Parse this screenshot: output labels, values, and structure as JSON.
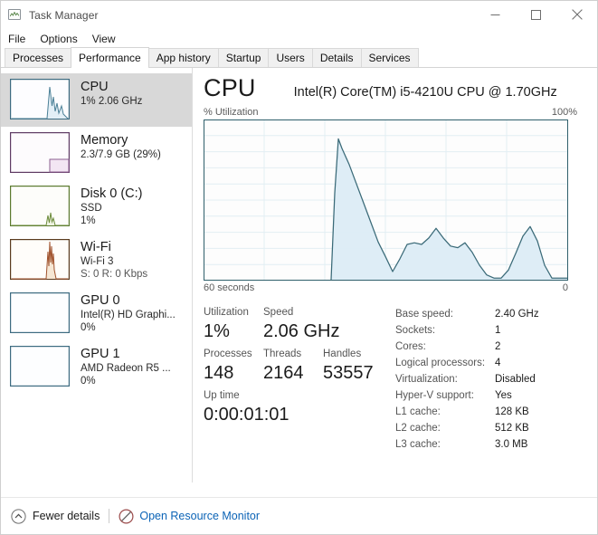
{
  "window": {
    "title": "Task Manager",
    "icon": "task-manager-icon",
    "minimize_label": "Minimize",
    "maximize_label": "Maximize",
    "close_label": "Close"
  },
  "menubar": {
    "items": [
      {
        "label": "File"
      },
      {
        "label": "Options"
      },
      {
        "label": "View"
      }
    ]
  },
  "tabs": [
    {
      "label": "Processes",
      "active": false
    },
    {
      "label": "Performance",
      "active": true
    },
    {
      "label": "App history",
      "active": false
    },
    {
      "label": "Startup",
      "active": false
    },
    {
      "label": "Users",
      "active": false
    },
    {
      "label": "Details",
      "active": false
    },
    {
      "label": "Services",
      "active": false
    }
  ],
  "sidebar": {
    "items": [
      {
        "name": "cpu",
        "title": "CPU",
        "line1": "1%  2.06 GHz",
        "line2": "",
        "selected": true,
        "accent": "#4a90a4"
      },
      {
        "name": "memory",
        "title": "Memory",
        "line1": "2.3/7.9 GB (29%)",
        "line2": "",
        "selected": false,
        "accent": "#6b3f6e"
      },
      {
        "name": "disk-0-c",
        "title": "Disk 0 (C:)",
        "line1": "SSD",
        "line2": "1%",
        "selected": false,
        "accent": "#5b7a2e"
      },
      {
        "name": "wifi",
        "title": "Wi-Fi",
        "line1": "Wi-Fi 3",
        "line2": "S: 0 R: 0 Kbps",
        "selected": false,
        "accent": "#a0522d"
      },
      {
        "name": "gpu-0",
        "title": "GPU 0",
        "line1": "Intel(R) HD Graphi...",
        "line2": "0%",
        "selected": false,
        "accent": "#3d6b80"
      },
      {
        "name": "gpu-1",
        "title": "GPU 1",
        "line1": "AMD Radeon R5 ...",
        "line2": "0%",
        "selected": false,
        "accent": "#3d6b80"
      }
    ]
  },
  "main": {
    "title": "CPU",
    "model": "Intel(R) Core(TM) i5-4210U CPU @ 1.70GHz",
    "chart_axis_label": "% Utilization",
    "chart_max_label": "100%",
    "chart_time_left": "60 seconds",
    "chart_time_right": "0",
    "stats": [
      {
        "label": "Utilization",
        "value": "1%"
      },
      {
        "label": "Speed",
        "value": "2.06 GHz"
      },
      {
        "label": "Processes",
        "value": "148"
      },
      {
        "label": "Threads",
        "value": "2164"
      },
      {
        "label": "Handles",
        "value": "53557"
      },
      {
        "label": "Up time",
        "value": "0:00:01:01"
      }
    ],
    "specs": [
      {
        "key": "Base speed:",
        "value": "2.40 GHz"
      },
      {
        "key": "Sockets:",
        "value": "1"
      },
      {
        "key": "Cores:",
        "value": "2"
      },
      {
        "key": "Logical processors:",
        "value": "4"
      },
      {
        "key": "Virtualization:",
        "value": "Disabled"
      },
      {
        "key": "Hyper-V support:",
        "value": "Yes"
      },
      {
        "key": "L1 cache:",
        "value": "128 KB"
      },
      {
        "key": "L2 cache:",
        "value": "512 KB"
      },
      {
        "key": "L3 cache:",
        "value": "3.0 MB"
      }
    ]
  },
  "chart_data": {
    "type": "area",
    "title": "% Utilization",
    "xlabel": "60 seconds",
    "ylabel": "% Utilization",
    "xlim": [
      60,
      0
    ],
    "ylim": [
      0,
      100
    ],
    "grid": true,
    "grid_cols": 6,
    "grid_rows": 10,
    "line_color": "#3a6a78",
    "fill_color": "#dcecf5",
    "series": [
      {
        "name": "CPU utilization",
        "x": [
          60,
          39,
          37,
          36.2,
          35.6,
          34.6,
          33.4,
          32,
          30.8,
          29.6,
          28.4,
          27.2,
          26,
          24.8,
          23.6,
          22.4,
          21.2,
          20,
          18.8,
          17.6,
          16.4,
          15.2,
          14,
          12.8,
          11.6,
          10.4,
          9.2,
          8,
          6.8,
          5.6,
          4.4,
          3.2,
          2,
          1,
          0
        ],
        "values": [
          0,
          0,
          0,
          54,
          88,
          82,
          72,
          58,
          44,
          30,
          16,
          5,
          13,
          22,
          23,
          22,
          26,
          32,
          26,
          21,
          20,
          23,
          17,
          9,
          3,
          1,
          1,
          6,
          16,
          27,
          33,
          24,
          9,
          1,
          1
        ]
      }
    ]
  },
  "statusbar": {
    "fewer_details_label": "Fewer details",
    "fewer_details_icon": "chevron-up-circle-icon",
    "resource_monitor_label": "Open Resource Monitor",
    "resource_monitor_icon": "resource-monitor-icon"
  }
}
